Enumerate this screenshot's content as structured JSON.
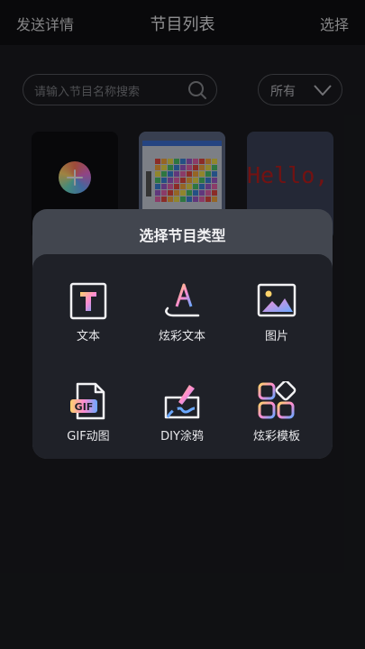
{
  "header": {
    "left": "发送详情",
    "title": "节目列表",
    "right": "选择"
  },
  "search": {
    "placeholder": "请输入节目名称搜索"
  },
  "filter": {
    "value": "所有"
  },
  "hello_card": {
    "text": "Hello,"
  },
  "modal": {
    "title": "选择节目类型",
    "options": [
      {
        "label": "文本",
        "icon": "text-t-icon"
      },
      {
        "label": "炫彩文本",
        "icon": "colorful-text-icon"
      },
      {
        "label": "图片",
        "icon": "image-icon"
      },
      {
        "label": "GIF动图",
        "icon": "gif-file-icon"
      },
      {
        "label": "DIY涂鸦",
        "icon": "paint-brush-icon"
      },
      {
        "label": "炫彩模板",
        "icon": "template-grid-icon"
      }
    ]
  }
}
